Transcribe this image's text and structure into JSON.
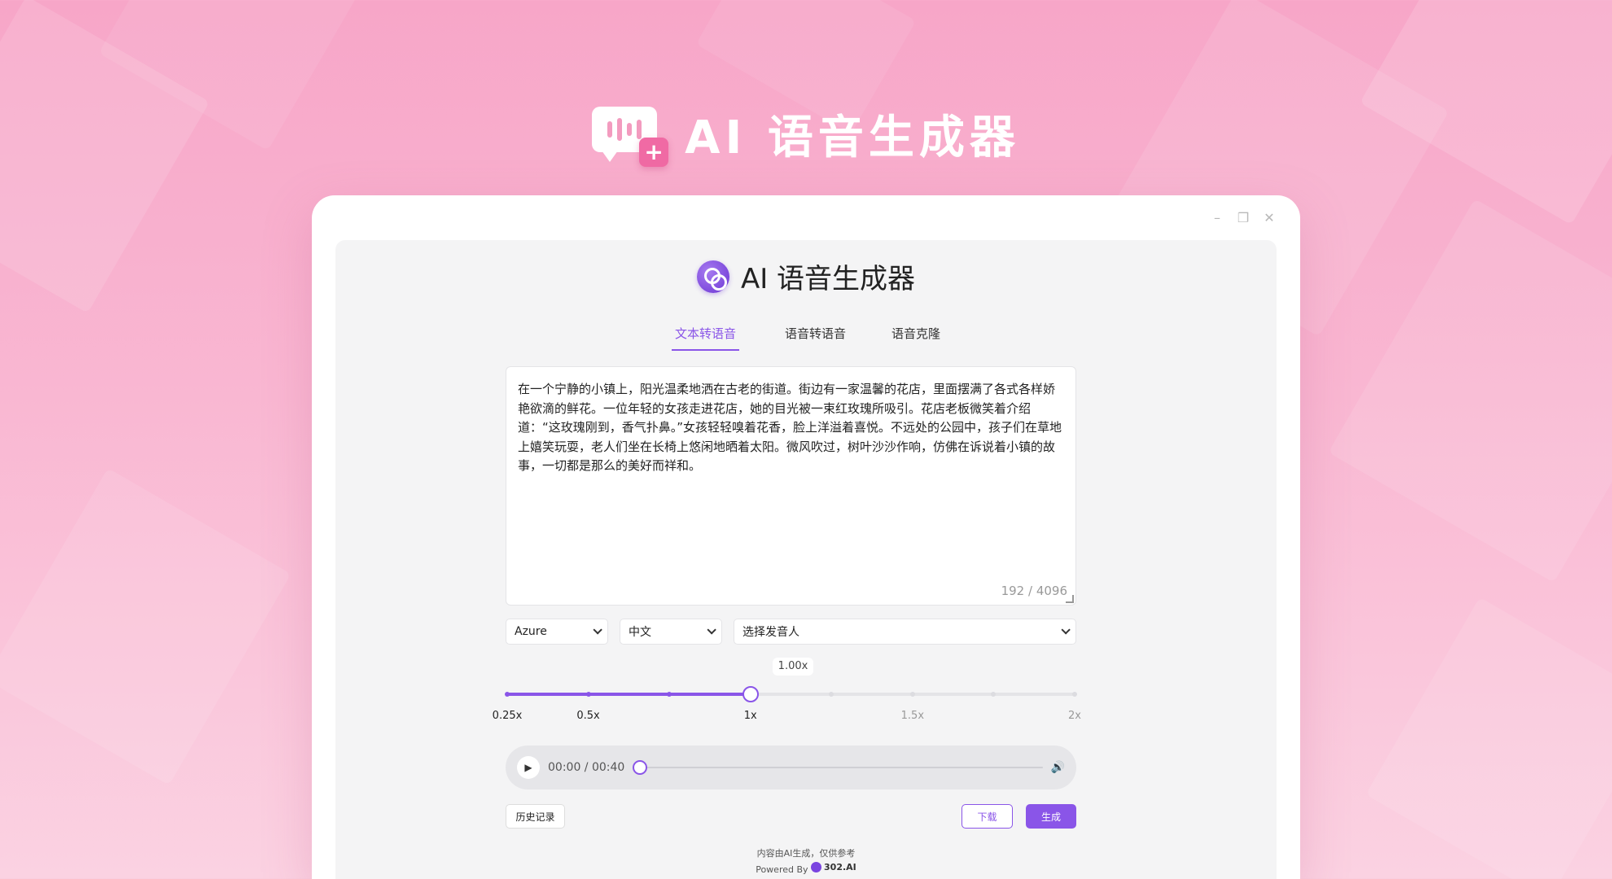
{
  "hero": {
    "title": "AI 语音生成器",
    "icon": "voice-bubble-plus-icon"
  },
  "window": {
    "controls": [
      "–",
      "❐",
      "✕"
    ]
  },
  "app": {
    "title": "AI 语音生成器",
    "logo": "302-ai-logo-icon",
    "accent": "#8a55e8"
  },
  "tabs": [
    {
      "label": "文本转语音",
      "active": true
    },
    {
      "label": "语音转语音",
      "active": false
    },
    {
      "label": "语音克隆",
      "active": false
    }
  ],
  "editor": {
    "text": "在一个宁静的小镇上，阳光温柔地洒在古老的街道。街边有一家温馨的花店，里面摆满了各式各样娇艳欲滴的鲜花。一位年轻的女孩走进花店，她的目光被一束红玫瑰所吸引。花店老板微笑着介绍道：“这玫瑰刚到，香气扑鼻。”女孩轻轻嗅着花香，脸上洋溢着喜悦。不远处的公园中，孩子们在草地上嬉笑玩耍，老人们坐在长椅上悠闲地晒着太阳。微风吹过，树叶沙沙作响，仿佛在诉说着小镇的故事，一切都是那么的美好而祥和。",
    "counter": "192 / 4096"
  },
  "selects": {
    "provider": "Azure",
    "language": "中文",
    "voice": "选择发音人"
  },
  "speed": {
    "value_label": "1.00x",
    "value": 1.0,
    "min": 0.25,
    "max": 2,
    "ticks": [
      {
        "label": "0.25x",
        "value": 0.25
      },
      {
        "label": "0.5x",
        "value": 0.5
      },
      {
        "label": "1x",
        "value": 1
      },
      {
        "label": "1.5x",
        "value": 1.5
      },
      {
        "label": "2x",
        "value": 2
      }
    ]
  },
  "player": {
    "time": "00:00 / 00:40",
    "progress": 0,
    "play_icon": "play-icon",
    "volume_icon": "volume-icon"
  },
  "buttons": {
    "history": "历史记录",
    "download": "下载",
    "generate": "生成"
  },
  "footer": {
    "disclaimer": "内容由AI生成，仅供参考",
    "powered_by": "Powered By",
    "brand": "302.AI"
  }
}
